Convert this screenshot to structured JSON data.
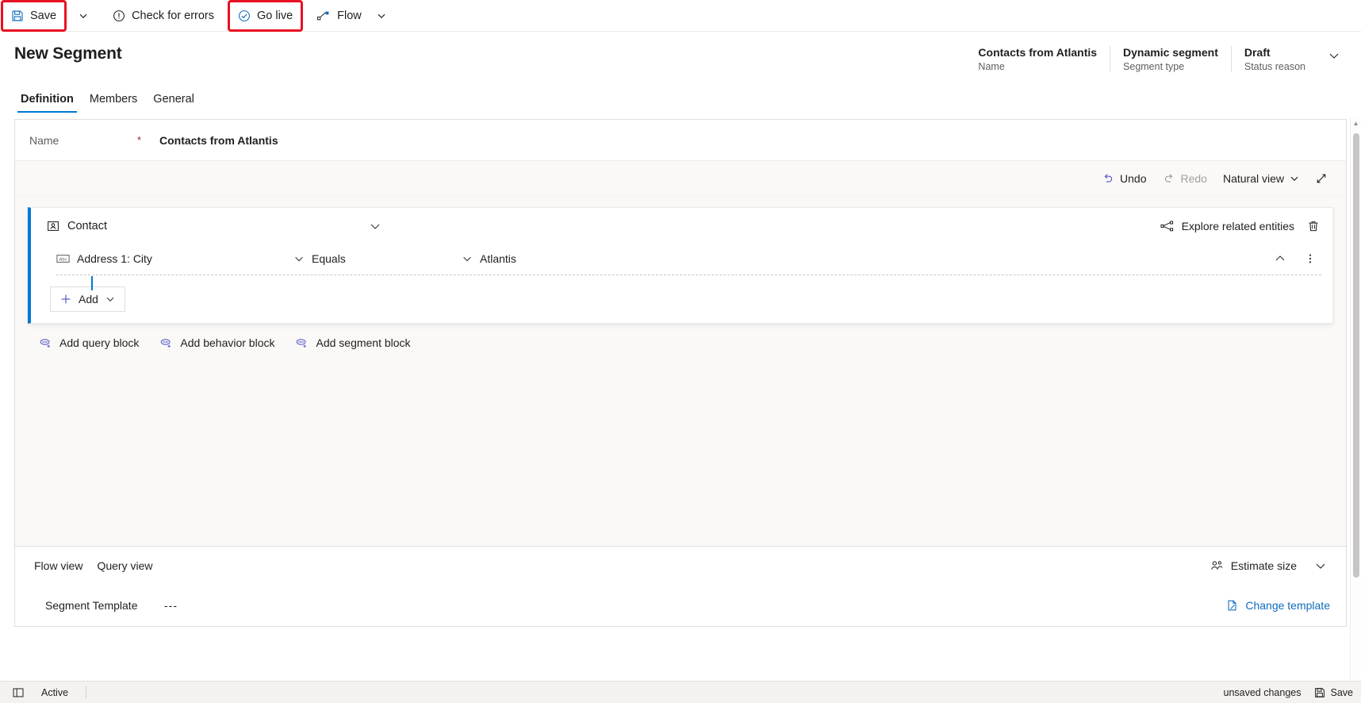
{
  "commandbar": {
    "save_label": "Save",
    "save_highlighted": true,
    "save_caret_icon": "chevron-down-icon",
    "check_errors_label": "Check for errors",
    "check_errors_icon": "error-circle-icon",
    "go_live_label": "Go live",
    "go_live_icon": "check-circle-icon",
    "go_live_highlighted": true,
    "flow_label": "Flow",
    "flow_icon": "flow-icon",
    "flow_caret_icon": "chevron-down-icon",
    "highlight_color": "#e81123"
  },
  "header": {
    "title": "New Segment",
    "meta": [
      {
        "value": "Contacts from Atlantis",
        "label": "Name"
      },
      {
        "value": "Dynamic segment",
        "label": "Segment type"
      },
      {
        "value": "Draft",
        "label": "Status reason"
      }
    ],
    "expand_icon": "chevron-down-icon",
    "tabs": [
      {
        "label": "Definition",
        "active": true
      },
      {
        "label": "Members",
        "active": false
      },
      {
        "label": "General",
        "active": false
      }
    ],
    "accent_color": "#0078d4"
  },
  "form": {
    "name_label": "Name",
    "required_mark": "*",
    "name_value": "Contacts from Atlantis"
  },
  "editor_toolbar": {
    "undo_label": "Undo",
    "undo_icon": "undo-icon",
    "redo_label": "Redo",
    "redo_icon": "redo-icon",
    "redo_disabled": true,
    "view_mode_label": "Natural view",
    "view_mode_caret": "chevron-down-icon",
    "expand_label": "",
    "expand_icon": "expand-diagonal-icon"
  },
  "query_block": {
    "entity_label": "Contact",
    "entity_icon": "contact-entity-icon",
    "collapse_icon": "chevron-down-icon",
    "explore_label": "Explore related entities",
    "explore_icon": "share-nodes-icon",
    "delete_icon": "trash-icon",
    "condition": {
      "field": "Address 1: City",
      "field_icon": "text-field-icon",
      "operator": "Equals",
      "value": "Atlantis",
      "collapse_icon": "chevron-up-icon",
      "more_icon": "more-vertical-icon"
    },
    "add_label": "Add",
    "add_icon": "plus-icon",
    "add_caret_icon": "chevron-down-icon"
  },
  "block_links": [
    {
      "label": "Add query block",
      "icon": "add-block-icon"
    },
    {
      "label": "Add behavior block",
      "icon": "add-block-icon"
    },
    {
      "label": "Add segment block",
      "icon": "add-block-icon"
    }
  ],
  "bottom_panel": {
    "tabs": [
      {
        "label": "Flow view"
      },
      {
        "label": "Query view"
      }
    ],
    "estimate_label": "Estimate size",
    "estimate_icon": "people-icon",
    "expand_caret_icon": "chevron-down-icon",
    "template_label": "Segment Template",
    "template_value": "---",
    "change_template_label": "Change template",
    "change_template_icon": "document-edit-icon",
    "link_color": "#0f6cbd"
  },
  "statusbar": {
    "layout_icon": "layout-icon",
    "state_label": "Active",
    "unsaved_label": "unsaved changes",
    "save_label": "Save",
    "save_icon": "save-icon"
  }
}
